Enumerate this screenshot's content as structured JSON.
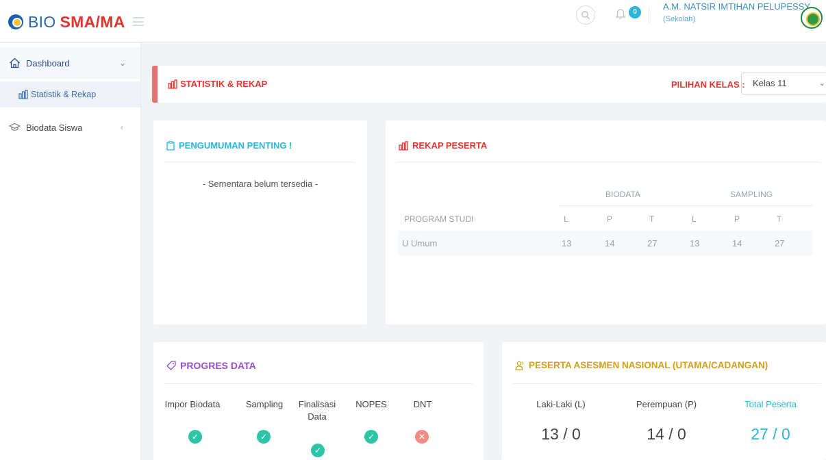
{
  "header": {
    "logo_part1": "BIO",
    "logo_part2": "SMA/MA",
    "notification_count": "0",
    "user_name": "A.M. NATSIR IMTIHAN PELUPESSY",
    "user_role": "(Sekolah)"
  },
  "sidebar": {
    "items": [
      {
        "label": "Dashboard"
      },
      {
        "label": "Statistik & Rekap"
      },
      {
        "label": "Biodata Siswa"
      }
    ]
  },
  "statistik": {
    "title": "STATISTIK & REKAP",
    "kelas_label": "PILIHAN KELAS :",
    "kelas_value": "Kelas 11"
  },
  "pengumuman": {
    "title": "PENGUMUMAN PENTING !",
    "text": "- Sementara belum tersedia -"
  },
  "rekap": {
    "title": "REKAP PESERTA",
    "group_biodata": "BIODATA",
    "group_sampling": "SAMPLING",
    "col_program": "PROGRAM STUDI",
    "sub_cols": [
      "L",
      "P",
      "T",
      "L",
      "P",
      "T"
    ],
    "rows": [
      {
        "program": "U Umum",
        "values": [
          "13",
          "14",
          "27",
          "13",
          "14",
          "27"
        ]
      }
    ]
  },
  "progres": {
    "title": "PROGRES DATA",
    "items": [
      {
        "label": "Impor Biodata",
        "status": "done"
      },
      {
        "label": "Sampling",
        "status": "done"
      },
      {
        "label": "Finalisasi Data",
        "status": "done"
      },
      {
        "label": "NOPES",
        "status": "done"
      },
      {
        "label": "DNT",
        "status": "not-done"
      }
    ]
  },
  "asesmen": {
    "title": "PESERTA ASESMEN NASIONAL (UTAMA/CADANGAN)",
    "laki_label": "Laki-Laki (L)",
    "laki_value": "13 / 0",
    "perempuan_label": "Perempuan (P)",
    "perempuan_value": "14 / 0",
    "total_label": "Total Peserta",
    "total_value": "27 / 0"
  },
  "colors": {
    "accent_red": "#e3342f",
    "accent_cyan": "#29b6d8",
    "accent_purple": "#9c4dcc",
    "accent_gold": "#d4a017",
    "check_green": "#2ec4a6",
    "cross_red": "#f28b82"
  }
}
